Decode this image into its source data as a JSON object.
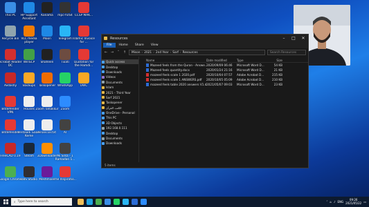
{
  "desktop_icons": [
    {
      "label": "This PC",
      "icon": "computer-icon",
      "color": "#3a8ee6",
      "col": 0,
      "row": 0
    },
    {
      "label": "HP Support Assistant",
      "icon": "help-icon",
      "color": "#1e88e5",
      "col": 1,
      "row": 0
    },
    {
      "label": "Kanama",
      "icon": "media-icon",
      "color": "#222222",
      "col": 2,
      "row": 0
    },
    {
      "label": "mpc-hc64",
      "icon": "film-icon",
      "color": "#333333",
      "col": 3,
      "row": 0
    },
    {
      "label": "CCSP MAK...",
      "icon": "pdf-icon",
      "color": "#e53935",
      "col": 4,
      "row": 0
    },
    {
      "label": "Recycle Bin",
      "icon": "recycle-bin-icon",
      "color": "#90a4ae",
      "col": 0,
      "row": 1
    },
    {
      "label": "VLC media player",
      "icon": "vlc-icon",
      "color": "#f57c00",
      "col": 1,
      "row": 1
    },
    {
      "label": "Moon",
      "icon": "document-icon",
      "color": "#1e88e5",
      "col": 2,
      "row": 1
    },
    {
      "label": "Telegram",
      "icon": "telegram-icon",
      "color": "#29b6f6",
      "col": 3,
      "row": 1
    },
    {
      "label": "Islamic Invoice for ...",
      "icon": "pdf-icon",
      "color": "#e53935",
      "col": 4,
      "row": 1
    },
    {
      "label": "Acrobat Reader DC",
      "icon": "acrobat-icon",
      "color": "#d32f2f",
      "col": 0,
      "row": 2
    },
    {
      "label": "WinSCP",
      "icon": "winscp-icon",
      "color": "#43a047",
      "col": 1,
      "row": 2
    },
    {
      "label": "Shaheen",
      "icon": "app-icon",
      "color": "#212121",
      "col": 2,
      "row": 2
    },
    {
      "label": "Tixati",
      "icon": "app-icon",
      "color": "#6d4c41",
      "col": 3,
      "row": 2
    },
    {
      "label": "Quotation for the Hamdi...",
      "icon": "pdf-icon",
      "color": "#e53935",
      "col": 4,
      "row": 2
    },
    {
      "label": "Avdashy",
      "icon": "app-icon",
      "color": "#c62828",
      "col": 0,
      "row": 3
    },
    {
      "label": "Backups",
      "icon": "folder-icon",
      "color": "#f9a825",
      "col": 1,
      "row": 3
    },
    {
      "label": "Taskopener",
      "icon": "app-icon",
      "color": "#ef6c00",
      "col": 2,
      "row": 3
    },
    {
      "label": "WhatsApp",
      "icon": "whatsapp-icon",
      "color": "#25d366",
      "col": 3,
      "row": 3
    },
    {
      "label": "UWC",
      "icon": "folder-icon",
      "color": "#f9a825",
      "col": 4,
      "row": 3
    },
    {
      "label": "Bitdefender VPN",
      "icon": "vpn-icon",
      "color": "#e53935",
      "col": 0,
      "row": 4
    },
    {
      "label": "Houses",
      "icon": "document-icon",
      "color": "#eeeeee",
      "col": 1,
      "row": 4
    },
    {
      "label": "Zoom Tahakkur",
      "icon": "document-icon",
      "color": "#eeeeee",
      "col": 2,
      "row": 4
    },
    {
      "label": "Zoom",
      "icon": "zoom-icon",
      "color": "#2d8cff",
      "col": 3,
      "row": 4
    },
    {
      "label": "Bitdefender",
      "icon": "bitdefender-icon",
      "color": "#e53935",
      "col": 0,
      "row": 5
    },
    {
      "label": "Verdaadi Gaam Keme",
      "icon": "document-icon",
      "color": "#eeeeee",
      "col": 1,
      "row": 5
    },
    {
      "label": "Financial.txt",
      "icon": "text-file-icon",
      "color": "#eeeeee",
      "col": 2,
      "row": 5
    },
    {
      "label": "Al",
      "icon": "app-icon",
      "color": "#424242",
      "col": 3,
      "row": 5
    },
    {
      "label": "FreeCAD 0.19",
      "icon": "freecad-icon",
      "color": "#c62828",
      "col": 0,
      "row": 6
    },
    {
      "label": "Steam",
      "icon": "steam-icon",
      "color": "#1b2838",
      "col": 1,
      "row": 6
    },
    {
      "label": "3Downloader",
      "icon": "app-icon",
      "color": "#ff8f00",
      "col": 2,
      "row": 6
    },
    {
      "label": "Mi Silsa - 1 Ramadan 1...",
      "icon": "media-icon",
      "color": "#424242",
      "col": 3,
      "row": 6
    },
    {
      "label": "Google Chrome",
      "icon": "chrome-icon",
      "color": "#4caf50",
      "col": 0,
      "row": 7
    },
    {
      "label": "OBS Studio",
      "icon": "obs-icon",
      "color": "#302e31",
      "col": 1,
      "row": 7
    },
    {
      "label": "Meshmixer",
      "icon": "app-icon",
      "color": "#6a1b9a",
      "col": 2,
      "row": 7
    },
    {
      "label": "The Inspiratio...",
      "icon": "pdf-icon",
      "color": "#e53935",
      "col": 3,
      "row": 7
    }
  ],
  "window": {
    "title": "Resources",
    "ribbon_tabs": [
      "File",
      "Home",
      "Share",
      "View"
    ],
    "address_parts": [
      "Mison",
      "2021",
      "2nd Year",
      "Sarf",
      "Resources"
    ],
    "search_placeholder": "Search Resources",
    "nav_items": [
      {
        "label": "Quick access",
        "icon": "star-icon",
        "color": "#4aa3ff",
        "selected": true
      },
      {
        "label": "Desktop",
        "icon": "desktop-icon",
        "color": "#4aa3ff",
        "selected": false
      },
      {
        "label": "Downloads",
        "icon": "downloads-icon",
        "color": "#4aa3ff",
        "selected": false
      },
      {
        "label": "Videos",
        "icon": "videos-icon",
        "color": "#9575cd",
        "selected": false
      },
      {
        "label": "Documents",
        "icon": "documents-icon",
        "color": "#90a4ae",
        "selected": false
      },
      {
        "label": "Islam",
        "icon": "folder-icon",
        "color": "#e5b94a",
        "selected": false
      },
      {
        "label": "2021 - Third Year",
        "icon": "folder-icon",
        "color": "#e5b94a",
        "selected": false
      },
      {
        "label": "Sarf 2021",
        "icon": "folder-icon",
        "color": "#e5b94a",
        "selected": false
      },
      {
        "label": "Taskopener",
        "icon": "folder-icon",
        "color": "#e5b94a",
        "selected": false
      },
      {
        "label": "الكتب القرآن",
        "icon": "folder-icon",
        "color": "#e5b94a",
        "selected": false
      },
      {
        "label": "OneDrive - Personal",
        "icon": "onedrive-icon",
        "color": "#4aa3ff",
        "selected": false
      },
      {
        "label": "This PC",
        "icon": "computer-icon",
        "color": "#4aa3ff",
        "selected": false
      },
      {
        "label": "3D Objects",
        "icon": "objects-icon",
        "color": "#4aa3ff",
        "selected": false
      },
      {
        "label": "192.168.0.111",
        "icon": "network-icon",
        "color": "#90a4ae",
        "selected": false
      },
      {
        "label": "Desktop",
        "icon": "desktop-icon",
        "color": "#4aa3ff",
        "selected": false
      },
      {
        "label": "Documents",
        "icon": "documents-icon",
        "color": "#90a4ae",
        "selected": false
      },
      {
        "label": "Downloads",
        "icon": "downloads-icon",
        "color": "#4aa3ff",
        "selected": false
      }
    ],
    "columns": [
      "Name",
      "Date modified",
      "Type",
      "Size"
    ],
    "files": [
      {
        "name": "Mazeed feels from the Quran - Answe...",
        "date": "2020/09/09 06:46",
        "type": "Microsoft Word D...",
        "size": "54 KB",
        "icon": "word-file-icon",
        "color": "#2b6cd6"
      },
      {
        "name": "Mazeed feels quantity.docx",
        "date": "2020/01/24 21:16",
        "type": "Microsoft Word D...",
        "size": "21 KB",
        "icon": "word-file-icon",
        "color": "#2b6cd6"
      },
      {
        "name": "mazeed feels scale 1 2020.pdf",
        "date": "2020/10/04 07:57",
        "type": "Adobe Acrobat D...",
        "size": "215 KB",
        "icon": "pdf-file-icon",
        "color": "#d32f2f"
      },
      {
        "name": "mazeed feels scale 1 ANSWERS.pdf",
        "date": "2020/10/05 05:09",
        "type": "Adobe Acrobat D...",
        "size": "210 KB",
        "icon": "pdf-file-icon",
        "color": "#d32f2f"
      },
      {
        "name": "mazeed feels table 2020 answers V1.d...",
        "date": "2021/05/07 09:03",
        "type": "Microsoft Word D...",
        "size": "23 KB",
        "icon": "word-file-icon",
        "color": "#2b6cd6"
      }
    ],
    "status": "5 items"
  },
  "taskbar": {
    "search_placeholder": "Type here to search",
    "apps": [
      {
        "icon": "file-explorer-icon",
        "color": "#f0c05a"
      },
      {
        "icon": "edge-icon",
        "color": "#1fa2e0"
      },
      {
        "icon": "chrome-icon",
        "color": "#4caf50"
      },
      {
        "icon": "store-icon",
        "color": "#3a8ee6"
      },
      {
        "icon": "whatsapp-icon",
        "color": "#25d366"
      },
      {
        "icon": "telegram-icon",
        "color": "#29b6f6"
      },
      {
        "icon": "word-icon",
        "color": "#2b6cd6"
      },
      {
        "icon": "zoom-icon",
        "color": "#2d8cff"
      }
    ],
    "language": "ENG",
    "time": "09:26",
    "date": "2021/05/22"
  }
}
